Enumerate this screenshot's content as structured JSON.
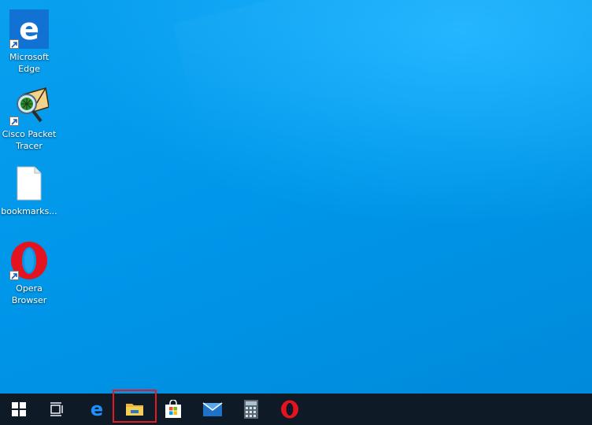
{
  "desktop": {
    "icons": [
      {
        "label": "Microsoft\nEdge",
        "icon": "edge-icon",
        "shortcut": true
      },
      {
        "label": "Cisco Packet\nTracer",
        "icon": "packet-tracer-icon",
        "shortcut": true
      },
      {
        "label": "bookmarks...",
        "icon": "file-icon",
        "shortcut": false
      },
      {
        "label": "Opera\nBrowser",
        "icon": "opera-icon",
        "shortcut": true
      }
    ]
  },
  "taskbar": {
    "items": [
      {
        "name": "start-button",
        "icon": "windows-logo-icon"
      },
      {
        "name": "task-view-button",
        "icon": "task-view-icon"
      },
      {
        "name": "edge",
        "icon": "edge-icon"
      },
      {
        "name": "file-explorer",
        "icon": "folder-icon",
        "highlighted": true
      },
      {
        "name": "microsoft-store",
        "icon": "store-icon"
      },
      {
        "name": "mail",
        "icon": "mail-icon"
      },
      {
        "name": "calculator",
        "icon": "calculator-icon"
      },
      {
        "name": "opera",
        "icon": "opera-icon"
      }
    ],
    "highlight_color": "#e01b24"
  }
}
